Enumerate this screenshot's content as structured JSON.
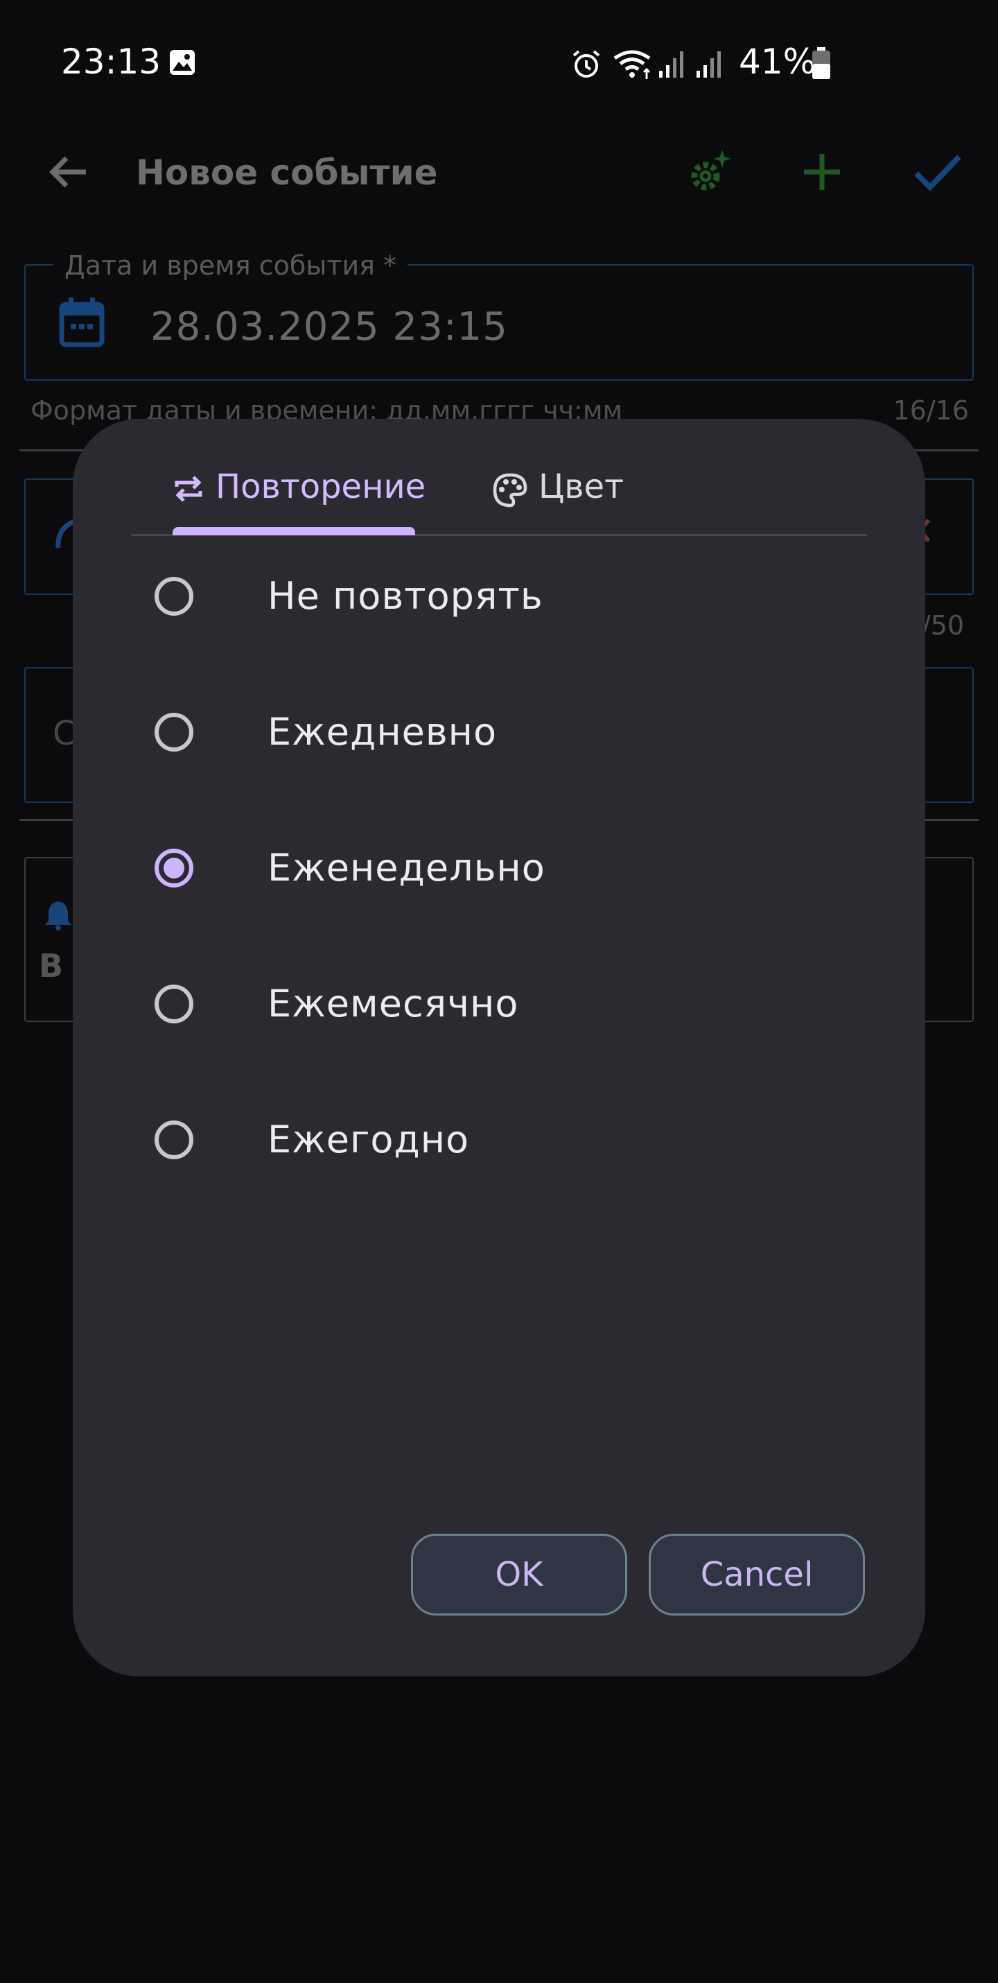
{
  "status_bar": {
    "time": "23:13",
    "battery": "41%"
  },
  "app_bar": {
    "title": "Новое событие",
    "icons": [
      "back-arrow-icon",
      "settings-sparkle-icon",
      "add-icon",
      "check-icon"
    ],
    "accent_colors": {
      "gear": "#2e7d32",
      "add": "#2e7d32",
      "check": "#1e5fa8"
    }
  },
  "form": {
    "datetime_label": "Дата и время события *",
    "datetime_value": "28.03.2025 23:15",
    "datetime_helper": "Формат даты и времени: дд.мм.гггг чч:мм",
    "datetime_counter": "16/16",
    "second_counter": "/50",
    "partial_text": "С",
    "bold_partial": "В"
  },
  "dialog": {
    "tabs": [
      {
        "label": "Повторение",
        "icon": "repeat-icon",
        "active": true
      },
      {
        "label": "Цвет",
        "icon": "palette-icon",
        "active": false
      }
    ],
    "options": [
      {
        "label": "Не повторять",
        "selected": false
      },
      {
        "label": "Ежедневно",
        "selected": false
      },
      {
        "label": "Еженедельно",
        "selected": true
      },
      {
        "label": "Ежемесячно",
        "selected": false
      },
      {
        "label": "Ежегодно",
        "selected": false
      }
    ],
    "ok_label": "OK",
    "cancel_label": "Cancel",
    "accent": "#cdb4ff",
    "background": "#2a2a30"
  }
}
